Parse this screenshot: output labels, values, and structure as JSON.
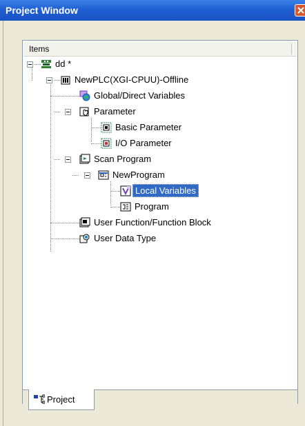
{
  "window": {
    "title": "Project Window"
  },
  "tree": {
    "header": "Items",
    "nodes": [
      {
        "label": "dd *",
        "icon": "project-icon"
      },
      {
        "label": "NewPLC(XGI-CPUU)-Offline",
        "icon": "plc-icon"
      },
      {
        "label": "Global/Direct Variables",
        "icon": "global-variables-icon"
      },
      {
        "label": "Parameter",
        "icon": "parameter-icon"
      },
      {
        "label": "Basic Parameter",
        "icon": "basic-parameter-icon"
      },
      {
        "label": "I/O Parameter",
        "icon": "io-parameter-icon"
      },
      {
        "label": "Scan Program",
        "icon": "scan-program-icon"
      },
      {
        "label": "NewProgram",
        "icon": "program-folder-icon"
      },
      {
        "label": "Local Variables",
        "icon": "local-variables-icon",
        "selected": true
      },
      {
        "label": "Program",
        "icon": "program-icon"
      },
      {
        "label": "User Function/Function Block",
        "icon": "function-block-icon"
      },
      {
        "label": "User Data Type",
        "icon": "data-type-icon"
      }
    ]
  },
  "tabs": [
    {
      "label": "Project",
      "icon": "project-tab-icon",
      "active": true
    }
  ],
  "colors": {
    "titlebar": "#1f5fd4",
    "selection": "#316ac5",
    "close": "#d9572f"
  }
}
